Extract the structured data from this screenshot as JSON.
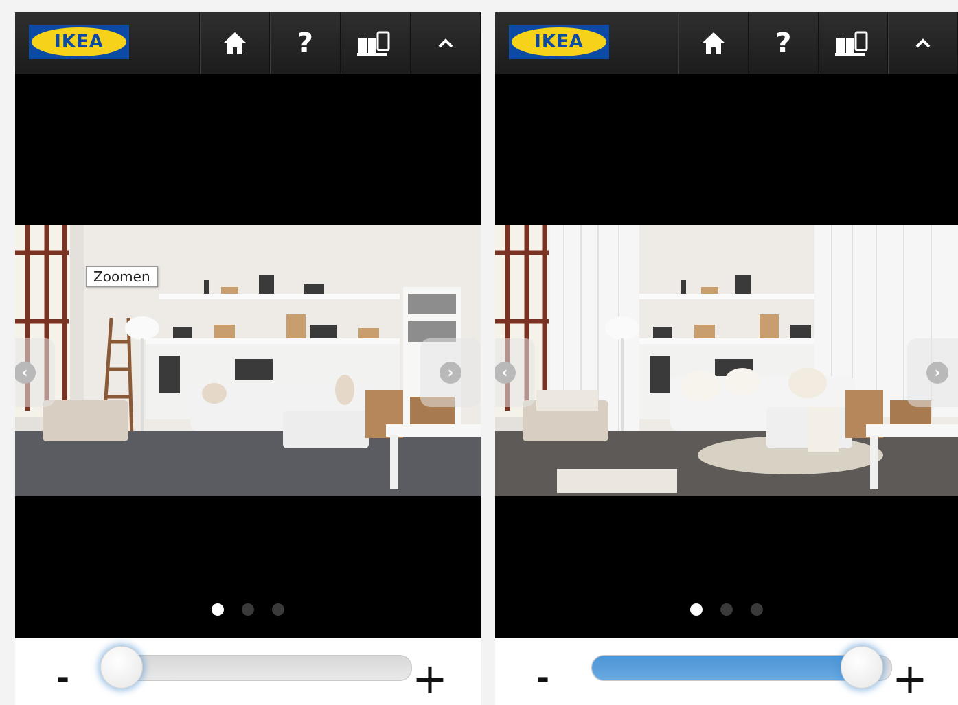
{
  "panels": [
    {
      "logo_text": "IKEA",
      "header_buttons": [
        {
          "icon": "home-icon"
        },
        {
          "icon": "help-icon",
          "glyph": "?"
        },
        {
          "icon": "catalog-icon"
        },
        {
          "icon": "chevron-up-icon"
        }
      ],
      "tooltip": "Zoomen",
      "nav": {
        "prev_glyph": "‹",
        "next_glyph": "›"
      },
      "carousel": {
        "dots": 3,
        "active_index": 0
      },
      "slider": {
        "minus": "-",
        "plus": "+",
        "value_fraction": 0.03
      },
      "scene_variant": "without-textiles"
    },
    {
      "logo_text": "IKEA",
      "header_buttons": [
        {
          "icon": "home-icon"
        },
        {
          "icon": "help-icon",
          "glyph": "?"
        },
        {
          "icon": "catalog-icon"
        },
        {
          "icon": "chevron-up-icon"
        }
      ],
      "nav": {
        "prev_glyph": "‹",
        "next_glyph": "›"
      },
      "carousel": {
        "dots": 3,
        "active_index": 0
      },
      "slider": {
        "minus": "-",
        "plus": "+",
        "value_fraction": 0.9
      },
      "scene_variant": "with-curtains-and-textiles"
    }
  ],
  "colors": {
    "brand_blue": "#0d4aa6",
    "brand_yellow": "#f7d21a",
    "slider_fill": "#4b95d6"
  }
}
